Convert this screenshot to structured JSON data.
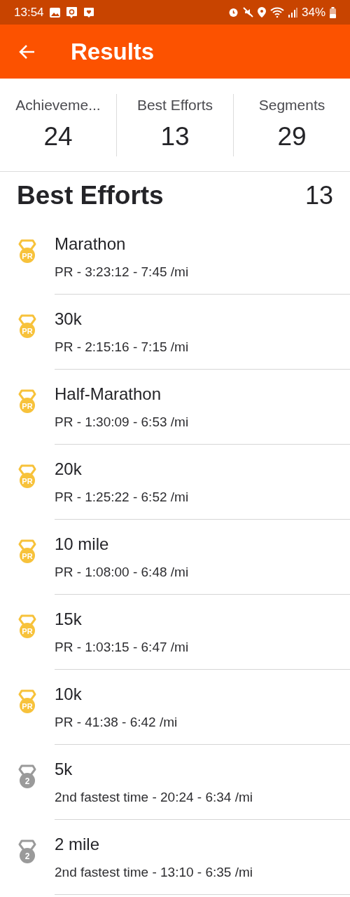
{
  "status_bar": {
    "time": "13:54",
    "battery": "34%"
  },
  "app_bar": {
    "title": "Results"
  },
  "tabs": [
    {
      "label": "Achieveme...",
      "count": "24"
    },
    {
      "label": "Best Efforts",
      "count": "13"
    },
    {
      "label": "Segments",
      "count": "29"
    }
  ],
  "section": {
    "title": "Best Efforts",
    "count": "13"
  },
  "efforts": [
    {
      "name": "Marathon",
      "detail": "PR - 3:23:12 - 7:45 /mi",
      "kind": "pr",
      "medal": "PR"
    },
    {
      "name": "30k",
      "detail": "PR - 2:15:16 - 7:15 /mi",
      "kind": "pr",
      "medal": "PR"
    },
    {
      "name": "Half-Marathon",
      "detail": "PR - 1:30:09 - 6:53 /mi",
      "kind": "pr",
      "medal": "PR"
    },
    {
      "name": "20k",
      "detail": "PR - 1:25:22 - 6:52 /mi",
      "kind": "pr",
      "medal": "PR"
    },
    {
      "name": "10 mile",
      "detail": "PR - 1:08:00 - 6:48 /mi",
      "kind": "pr",
      "medal": "PR"
    },
    {
      "name": "15k",
      "detail": "PR - 1:03:15 - 6:47 /mi",
      "kind": "pr",
      "medal": "PR"
    },
    {
      "name": "10k",
      "detail": "PR - 41:38 - 6:42 /mi",
      "kind": "pr",
      "medal": "PR"
    },
    {
      "name": "5k",
      "detail": "2nd fastest time - 20:24 - 6:34 /mi",
      "kind": "second",
      "medal": "2"
    },
    {
      "name": "2 mile",
      "detail": "2nd fastest time - 13:10 - 6:35 /mi",
      "kind": "second",
      "medal": "2"
    }
  ]
}
